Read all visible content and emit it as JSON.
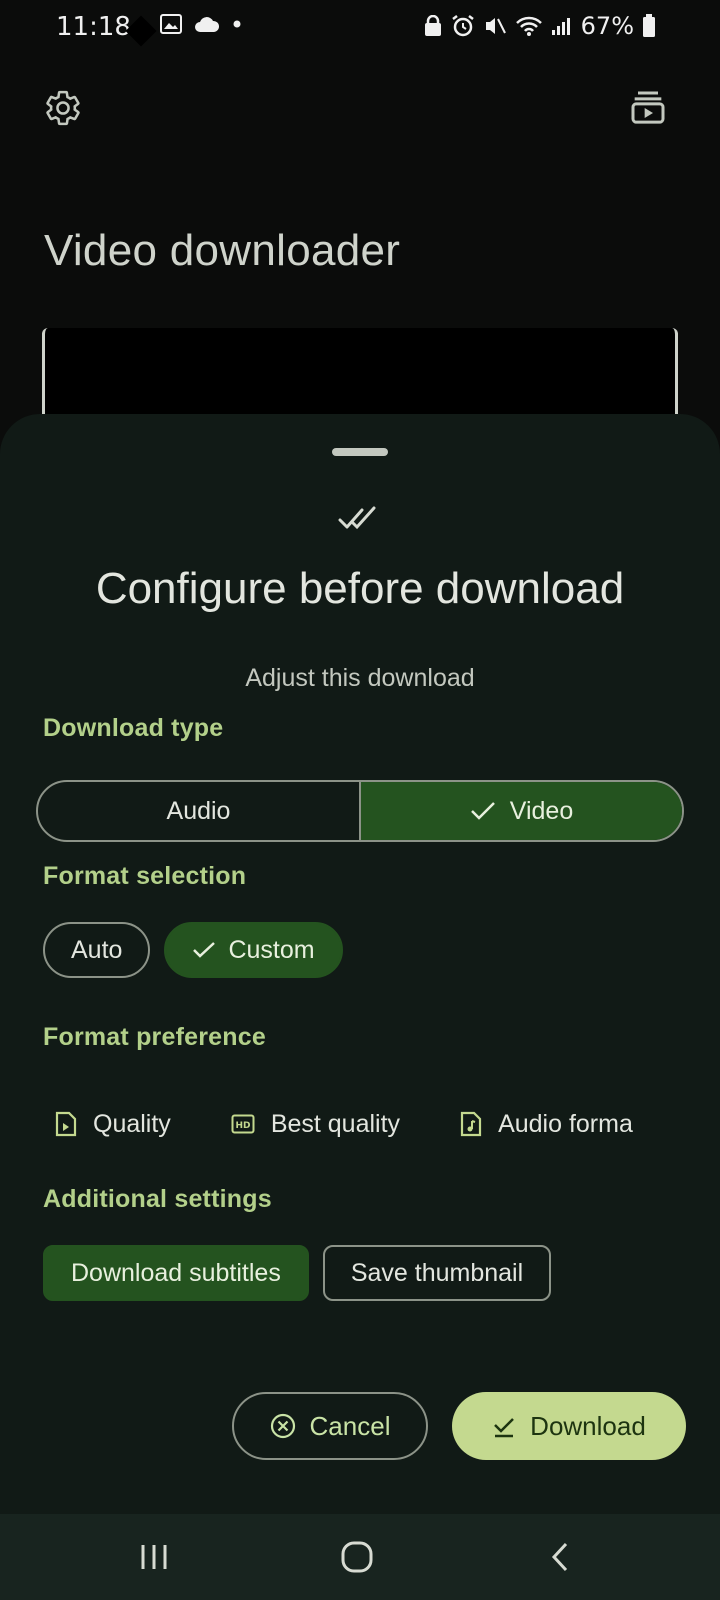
{
  "status_bar": {
    "time": "11:18",
    "battery": "67%"
  },
  "page": {
    "title": "Video downloader"
  },
  "sheet": {
    "title": "Configure before download",
    "subtitle": "Adjust this download",
    "download_type": {
      "label": "Download type",
      "options": [
        "Audio",
        "Video"
      ],
      "selected": "Video"
    },
    "format_selection": {
      "label": "Format selection",
      "options": [
        "Auto",
        "Custom"
      ],
      "selected": "Custom"
    },
    "format_preference": {
      "label": "Format preference",
      "items": [
        {
          "label": "Quality",
          "icon": "file-video-icon"
        },
        {
          "label": "Best quality",
          "icon": "hd-icon"
        },
        {
          "label": "Audio forma",
          "icon": "file-audio-icon"
        }
      ]
    },
    "additional_settings": {
      "label": "Additional settings",
      "download_subtitles": "Download subtitles",
      "save_thumbnail": "Save thumbnail"
    },
    "cancel_label": "Cancel",
    "download_label": "Download"
  },
  "colors": {
    "accent": "#b3d08a",
    "selected_bg": "#24531f",
    "primary_button": "#c4d98f",
    "sheet_bg": "#111a16"
  }
}
